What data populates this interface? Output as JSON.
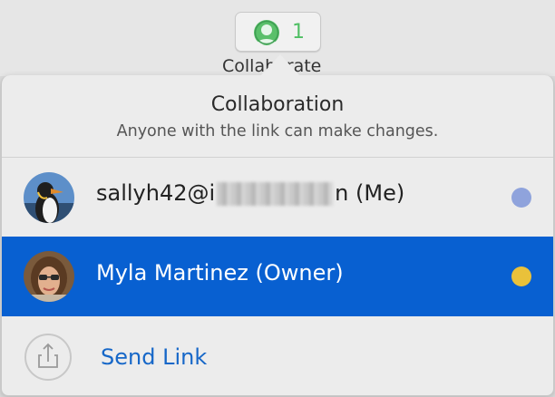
{
  "toolbar": {
    "collab_count": "1",
    "collab_label": "Collaborate"
  },
  "popover": {
    "title": "Collaboration",
    "subtitle": "Anyone with the link can make changes."
  },
  "participants": [
    {
      "name_prefix": "sallyh42@i",
      "name_suffix": "n (Me)",
      "avatar": "penguin-avatar",
      "dot_color": "#8fa3dc",
      "selected": false
    },
    {
      "name": "Myla Martinez (Owner)",
      "avatar": "person-photo-avatar",
      "dot_color": "#e9c13a",
      "selected": true
    }
  ],
  "actions": {
    "send_link_label": "Send Link",
    "send_link_icon": "share-icon"
  },
  "colors": {
    "selection_blue": "#0860d1",
    "collab_green": "#5ac06a",
    "link_blue": "#1667c8"
  }
}
